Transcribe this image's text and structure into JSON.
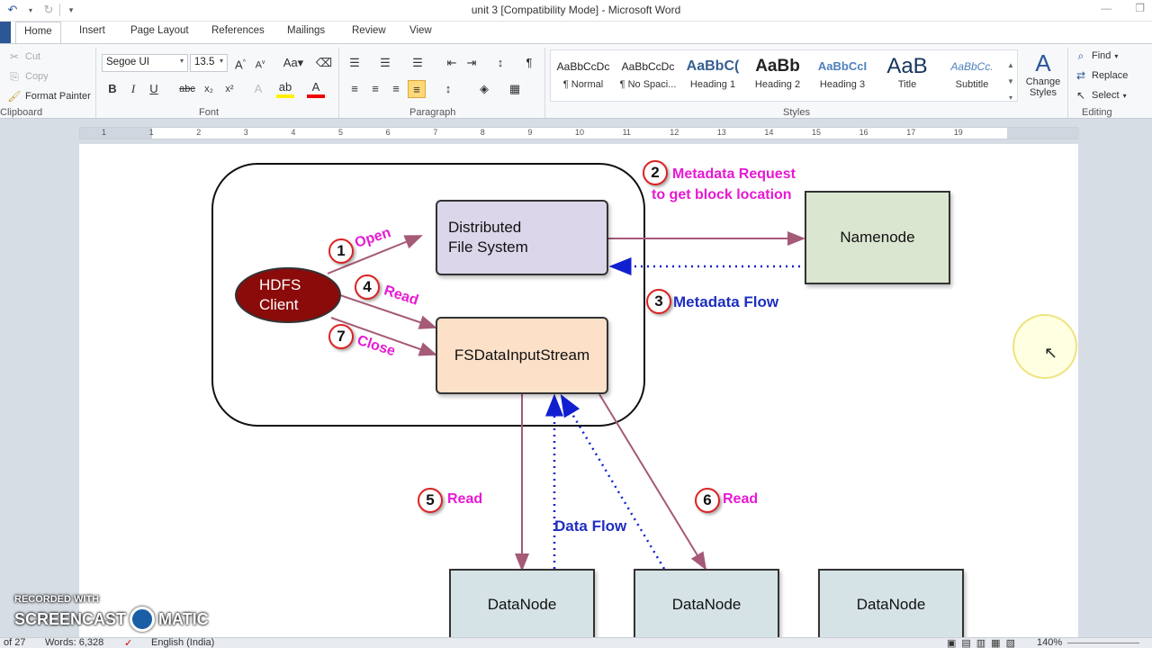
{
  "window": {
    "title": "unit 3 [Compatibility Mode] - Microsoft Word"
  },
  "tabs": [
    "Home",
    "Insert",
    "Page Layout",
    "References",
    "Mailings",
    "Review",
    "View"
  ],
  "clipboard": {
    "cut": "Cut",
    "copy": "Copy",
    "format_painter": "Format Painter",
    "label": "Clipboard"
  },
  "font": {
    "name": "Segoe UI",
    "size": "13.5",
    "label": "Font"
  },
  "paragraph": {
    "label": "Paragraph"
  },
  "styles": {
    "label": "Styles",
    "items": [
      {
        "preview": "AaBbCcDc",
        "name": "¶ Normal"
      },
      {
        "preview": "AaBbCcDc",
        "name": "¶ No Spaci..."
      },
      {
        "preview": "AaBbC(",
        "name": "Heading 1"
      },
      {
        "preview": "AaBb",
        "name": "Heading 2"
      },
      {
        "preview": "AaBbCcI",
        "name": "Heading 3"
      },
      {
        "preview": "AaB",
        "name": "Title"
      },
      {
        "preview": "AaBbCc.",
        "name": "Subtitle"
      }
    ],
    "change_styles": "Change Styles"
  },
  "editing": {
    "find": "Find",
    "replace": "Replace",
    "select": "Select",
    "label": "Editing"
  },
  "ruler": {
    "numbers": [
      "1",
      "1",
      "2",
      "3",
      "4",
      "5",
      "6",
      "7",
      "8",
      "9",
      "10",
      "11",
      "12",
      "13",
      "14",
      "15",
      "16",
      "17",
      "19"
    ]
  },
  "diagram": {
    "hdfs_client": [
      "HDFS",
      "Client"
    ],
    "dfs": [
      "Distributed",
      "File System"
    ],
    "fsdis": "FSDataInputStream",
    "namenode": "Namenode",
    "datanodes": [
      "DataNode",
      "DataNode",
      "DataNode"
    ],
    "labels": {
      "open": "Open",
      "read": "Read",
      "close": "Close",
      "meta_req_1": "Metadata Request",
      "meta_req_2": "to get block location",
      "meta_flow": "Metadata Flow",
      "read5": "Read",
      "read6": "Read",
      "data_flow": "Data Flow"
    },
    "numbers": [
      "1",
      "2",
      "3",
      "4",
      "5",
      "6",
      "7"
    ]
  },
  "status": {
    "page": "of 27",
    "words": "Words: 6,328",
    "language": "English (India)",
    "zoom": "140%"
  },
  "watermark": {
    "line1": "RECORDED WITH",
    "line2a": "SCREENCAST",
    "line2b": "MATIC"
  },
  "colors": {
    "accent": "#2b579a",
    "label_magenta": "#e619d3",
    "label_blue": "#1f2fbf",
    "client_fill": "#8b0b0b"
  }
}
